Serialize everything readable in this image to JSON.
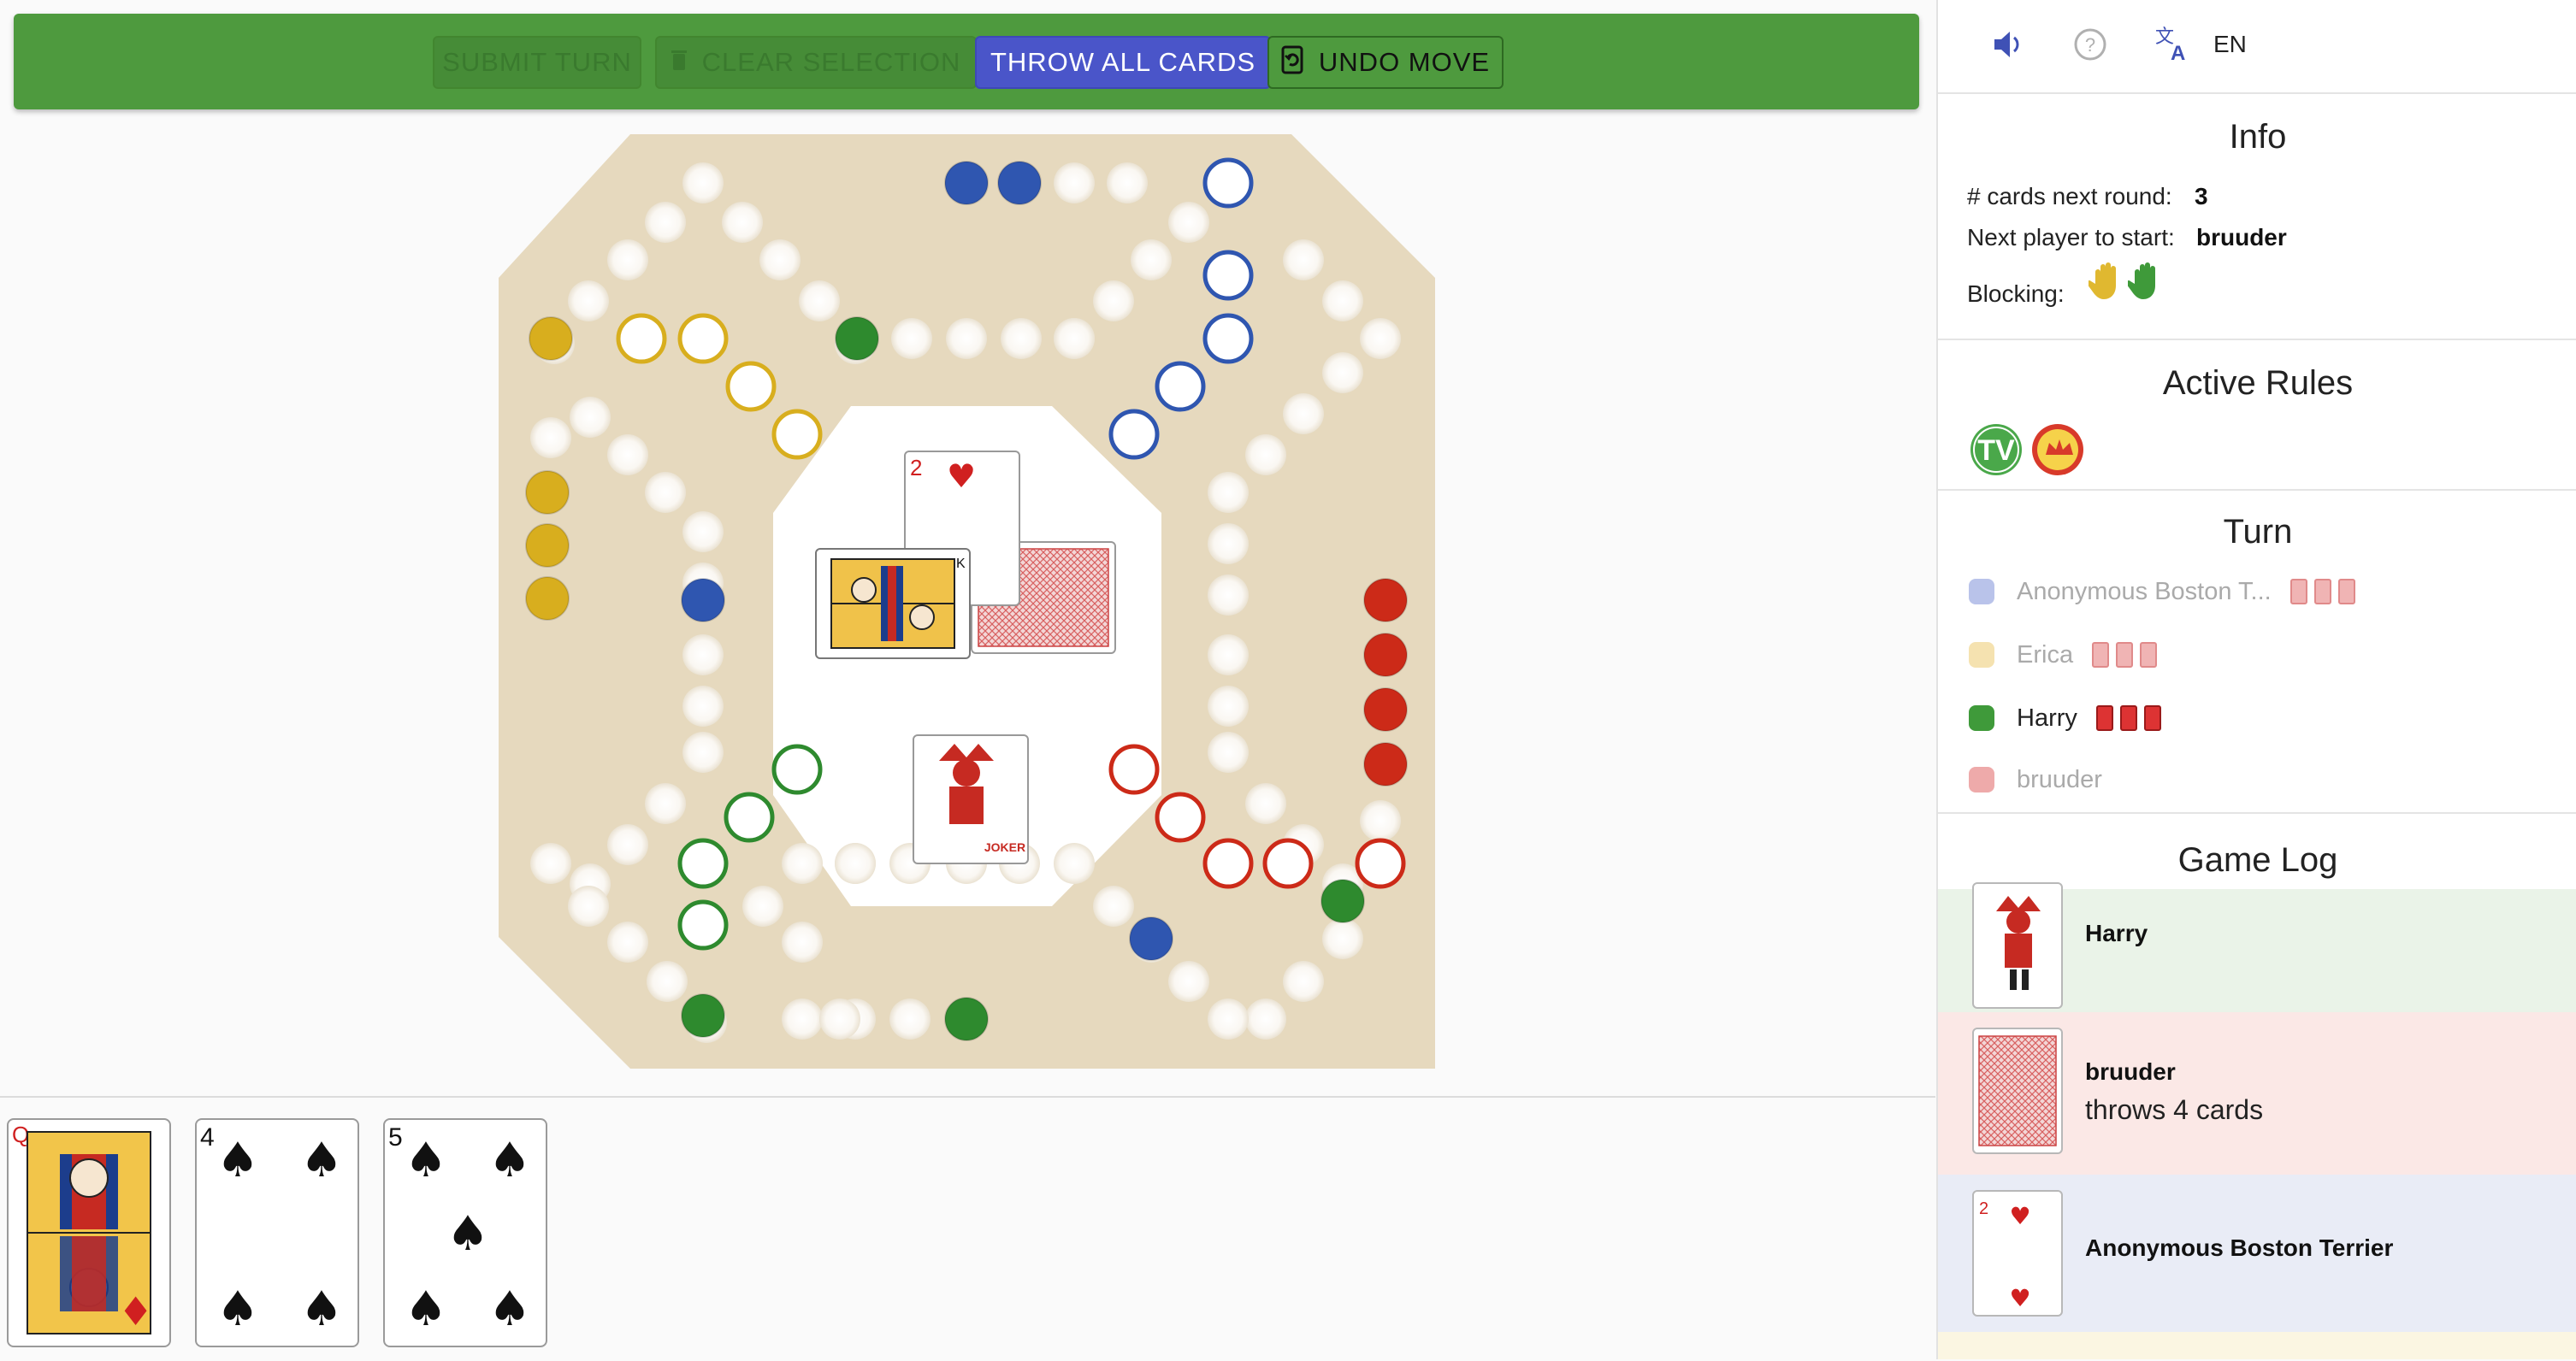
{
  "toolbar": {
    "submit_label": "SUBMIT TURN",
    "clear_label": "CLEAR SELECTION",
    "throw_label": "THROW ALL CARDS",
    "undo_label": "UNDO MOVE",
    "clear_icon": "trash-icon",
    "undo_icon": "undo-icon"
  },
  "header": {
    "sound_icon": "speaker-icon",
    "help_icon": "help-icon",
    "translate_icon": "translate-icon",
    "language": "EN"
  },
  "info": {
    "title": "Info",
    "cards_label": "# cards next round:",
    "cards_value": "3",
    "next_label": "Next player to start:",
    "next_value": "bruuder",
    "blocking_label": "Blocking:",
    "blocking_colors": [
      "#e0b830",
      "#3f9a3a"
    ]
  },
  "rules": {
    "title": "Active Rules",
    "icons": [
      "tv-rule-icon",
      "crown-rule-icon"
    ]
  },
  "turn": {
    "title": "Turn",
    "players": [
      {
        "name": "Anonymous Boston T...",
        "color": "#b9c3ea",
        "cards": 3,
        "active": false
      },
      {
        "name": "Erica",
        "color": "#f5e2b0",
        "cards": 3,
        "active": false
      },
      {
        "name": "Harry",
        "color": "#3f9a3a",
        "cards": 3,
        "active": true
      },
      {
        "name": "bruuder",
        "color": "#eeaaaa",
        "cards": 0,
        "active": false
      }
    ]
  },
  "log": {
    "title": "Game Log",
    "entries": [
      {
        "player": "Harry",
        "action": "",
        "card": "joker",
        "bg": "#eaf3e8"
      },
      {
        "player": "bruuder",
        "action": "throws 4 cards",
        "card": "back",
        "bg": "#fbe8e6"
      },
      {
        "player": "Anonymous Boston Terrier",
        "action": "",
        "card": "2 of hearts",
        "bg": "#e9ecf6"
      }
    ]
  },
  "center_pile": {
    "cards": [
      "king of spades",
      "2 of hearts",
      "card back",
      "joker"
    ],
    "labels": {
      "two_rank": "2",
      "king_rank": "K",
      "joker_text": "JOKER"
    }
  },
  "hand": {
    "cards": [
      {
        "rank": "Q",
        "suit": "♦",
        "name": "queen of diamonds"
      },
      {
        "rank": "4",
        "suit": "♠",
        "name": "4 of spades"
      },
      {
        "rank": "5",
        "suit": "♠",
        "name": "5 of spades"
      }
    ]
  },
  "colors": {
    "board": "#e6d9be",
    "blue": "#2f56b0",
    "yellow": "#d8ae1e",
    "green": "#2e8a2e",
    "red": "#cc2a18",
    "toolbar": "#4e9a3e",
    "primary": "#4a55c9"
  }
}
